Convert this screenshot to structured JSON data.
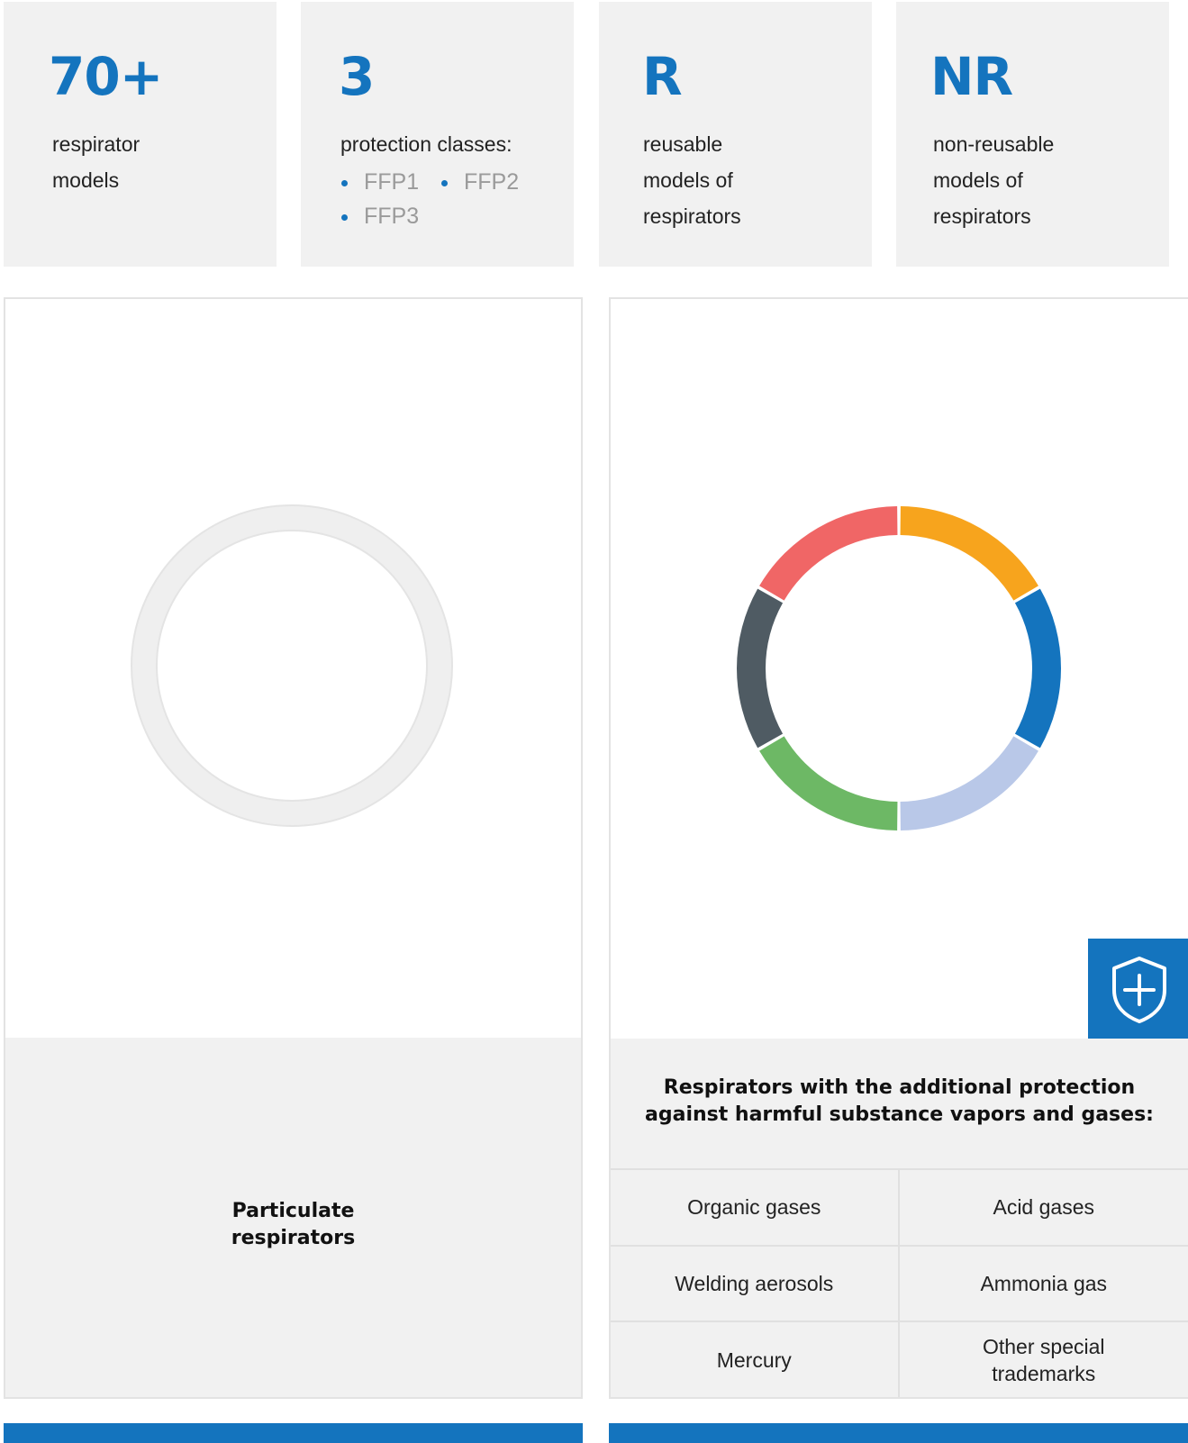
{
  "stats": [
    {
      "value": "70+",
      "lines": [
        "respirator",
        "models"
      ]
    },
    {
      "value": "3",
      "lines": [
        "protection classes:"
      ],
      "classes": [
        "FFP1",
        "FFP2",
        "FFP3"
      ]
    },
    {
      "value": "R",
      "lines": [
        "reusable",
        "models of",
        "respirators"
      ]
    },
    {
      "value": "NR",
      "lines": [
        "non-reusable",
        "models of",
        "respirators"
      ]
    }
  ],
  "particulate": {
    "title_lines": [
      "Particulate",
      "respirators"
    ]
  },
  "gas": {
    "title_lines": [
      "Respirators with the additional protection",
      "against harmful substance vapors and gases:"
    ],
    "items": [
      "Organic gases",
      "Acid gases",
      "Welding aerosols",
      "Ammonia gas",
      "Mercury",
      "Other special",
      "trademarks"
    ],
    "icon": "shield-plus-icon"
  },
  "chart_data": {
    "type": "pie",
    "segments": [
      {
        "value": 1,
        "color": "#f7a41d"
      },
      {
        "value": 1,
        "color": "#1474be"
      },
      {
        "value": 1,
        "color": "#b9c8e8"
      },
      {
        "value": 1,
        "color": "#6db865"
      },
      {
        "value": 1,
        "color": "#4f5b63"
      },
      {
        "value": 1,
        "color": "#f06666"
      }
    ]
  },
  "colors": {
    "accent": "#1474be",
    "panel_bg": "#f1f1f1",
    "ring_grey": "#efefef"
  }
}
